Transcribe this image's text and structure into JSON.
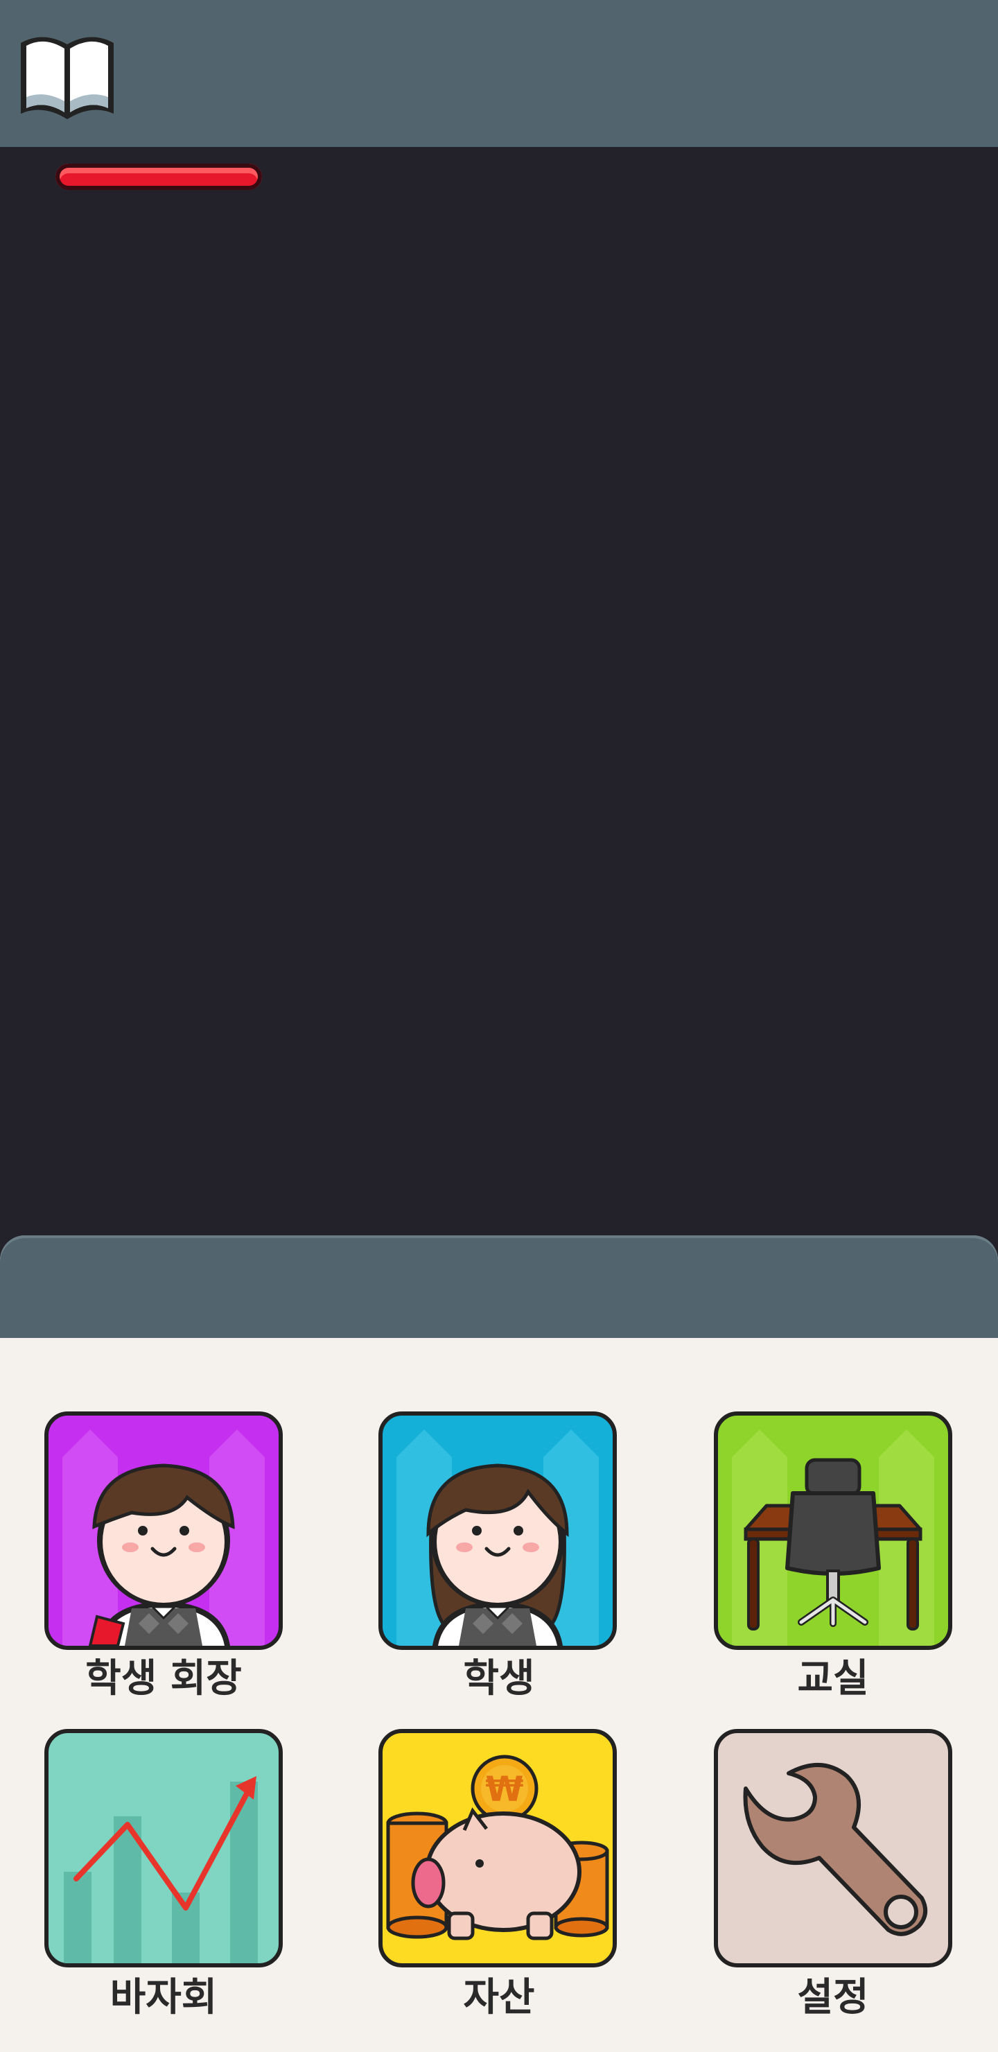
{
  "top_bar": {
    "book_icon": "open-book-icon"
  },
  "health": {
    "fill_fraction": 1.0,
    "color": "#e8182c"
  },
  "menu": {
    "items": [
      {
        "id": "student-president",
        "label": "학생 회장",
        "icon": "student-president-icon",
        "bg": "#c530f0"
      },
      {
        "id": "student",
        "label": "학생",
        "icon": "student-girl-icon",
        "bg": "#15b0d8"
      },
      {
        "id": "classroom",
        "label": "교실",
        "icon": "desk-chair-icon",
        "bg": "#8ed42a"
      },
      {
        "id": "bazaar",
        "label": "바자회",
        "icon": "rising-chart-icon",
        "bg": "#7fd5c2"
      },
      {
        "id": "assets",
        "label": "자산",
        "icon": "piggy-bank-icon",
        "bg": "#fddb22"
      },
      {
        "id": "settings",
        "label": "설정",
        "icon": "wrench-icon",
        "bg": "#e3d3cc"
      }
    ]
  }
}
